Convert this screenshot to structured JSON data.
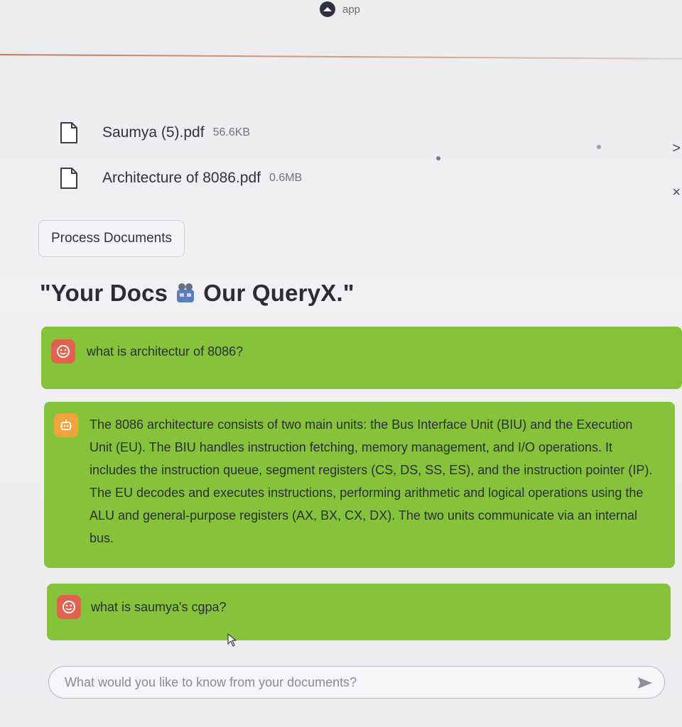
{
  "browser": {
    "app_name": "app",
    "logo_icon": "streamlit-logo-icon"
  },
  "files": [
    {
      "name": "Saumya (5).pdf",
      "size": "56.6KB",
      "icon": "file-icon"
    },
    {
      "name": "Architecture of 8086.pdf",
      "size": "0.6MB",
      "icon": "file-icon"
    }
  ],
  "side_controls": {
    "collapse_glyph": ">",
    "close_glyph": "×"
  },
  "actions": {
    "process_label": "Process Documents"
  },
  "heading": {
    "left": "\"Your Docs",
    "right": "Our QueryX.\"",
    "emoji_icon": "robot-emoji-icon"
  },
  "chat": {
    "messages": [
      {
        "role": "user",
        "text": "what is architectur of 8086?",
        "icon": "user-face-icon"
      },
      {
        "role": "assistant",
        "text": "The 8086 architecture consists of two main units: the Bus Interface Unit (BIU) and the Execution Unit (EU). The BIU handles instruction fetching, memory management, and I/O operations. It includes the instruction queue, segment registers (CS, DS, SS, ES), and the instruction pointer (IP). The EU decodes and executes instructions, performing arithmetic and logical operations using the ALU and general-purpose registers (AX, BX, CX, DX). The two units communicate via an internal bus.",
        "icon": "bot-icon"
      },
      {
        "role": "user",
        "text": "what is saumya's cgpa?",
        "icon": "user-face-icon"
      }
    ],
    "input": {
      "placeholder": "What would you like to know from your documents?",
      "value": ""
    },
    "send_icon": "send-arrow-icon"
  },
  "colors": {
    "bubble": "#85c43a",
    "user_avatar": "#e2624f",
    "bot_avatar": "#f0a43b",
    "accent_line": "#c77a52"
  }
}
